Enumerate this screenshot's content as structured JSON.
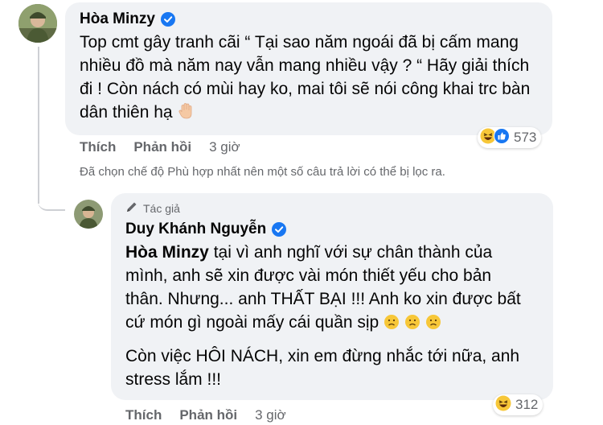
{
  "comment1": {
    "author": "Hòa Minzy",
    "text": "Top cmt gây tranh cãi “ Tại sao năm ngoái đã bị cấm mang nhiều đồ mà năm nay vẫn mang nhiều vậy ? “ Hãy giải thích đi ! Còn nách có mùi hay ko, mai tôi sẽ nói công khai trc bàn dân thiên hạ",
    "reaction_count": "573",
    "like_label": "Thích",
    "reply_label": "Phản hồi",
    "time": "3 giờ"
  },
  "filter_notice": "Đã chọn chế độ Phù hợp nhất nên một số câu trả lời có thể bị lọc ra.",
  "comment2": {
    "author_tag": "Tác giả",
    "author": "Duy Khánh Nguyễn",
    "mention": "Hòa Minzy",
    "text_p1": "tại vì anh nghĩ với sự chân thành của mình, anh sẽ xin được vài món thiết yếu cho bản thân. Nhưng... anh THẤT BẠI !!! Anh ko xin được bất cứ món gì ngoài mấy cái quần sịp",
    "text_p2": "Còn việc HÔI NÁCH, xin em đừng nhắc tới nữa, anh stress lắm !!!",
    "reaction_count": "312",
    "like_label": "Thích",
    "reply_label": "Phản hồi",
    "time": "3 giờ"
  },
  "colors": {
    "bubble": "#f0f2f5",
    "verified": "#1877f2",
    "meta": "#65676b"
  },
  "icons": [
    "verified-badge-icon",
    "raised-hand-emoji",
    "laughing-emoji",
    "like-icon",
    "sad-face-emoji",
    "pen-icon"
  ]
}
